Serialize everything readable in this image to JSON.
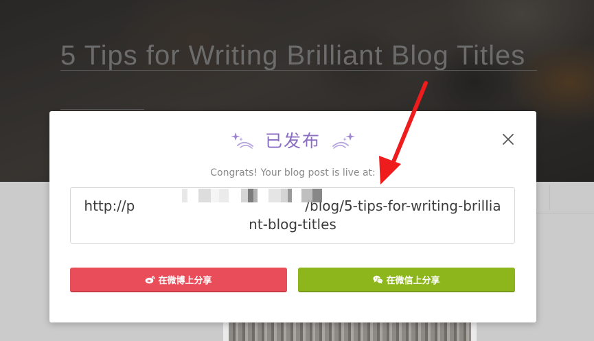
{
  "background_page": {
    "post_title": "5 Tips for Writing Brilliant Blog Titles"
  },
  "modal": {
    "title": "已发布",
    "congrats_text": "Congrats! Your blog post is live at:",
    "post_url": "http://p                                       /blog/5-tips-for-writing-brilliant-blog-titles",
    "share_weibo_label": "在微博上分享",
    "share_wechat_label": "在微信上分享",
    "close_icon": "close-icon",
    "sparkle_icon": "sparkle-star-icon",
    "weibo_icon": "weibo-icon",
    "wechat_icon": "wechat-icon"
  },
  "colors": {
    "title_accent": "#8c6dc4",
    "weibo_button": "#e94d5a",
    "wechat_button": "#8db61c",
    "annotation_arrow": "#ee1c1c"
  }
}
